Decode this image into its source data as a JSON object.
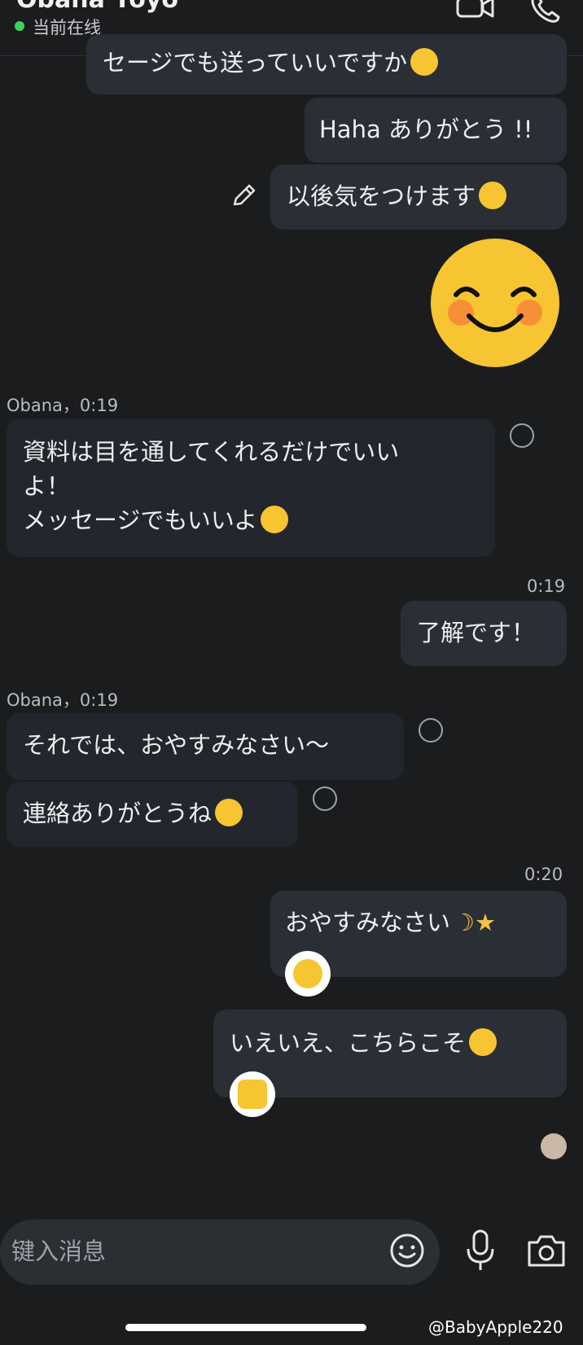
{
  "header": {
    "contact_name": "Obana Yoyo",
    "status_text": "当前在线",
    "video_call_icon": "video-camera-icon",
    "voice_call_icon": "phone-icon"
  },
  "messages": {
    "m1_text": "セージでも送っていいですか",
    "m2_text": "Haha ありがとう !!",
    "m3_text": "以後気をつけます",
    "m4_sender": "Obana，0:19",
    "m4_line1": "資料は目を通してくれるだけでいい",
    "m4_line2": "よ！",
    "m4_line3": "メッセージでもいいよ",
    "m5_time": "0:19",
    "m5_text": "了解です！",
    "m6_sender": "Obana，0:19",
    "m6_text": "それでは、おやすみなさい〜",
    "m7_text": "連絡ありがとうね",
    "m8_time": "0:20",
    "m8_text": "おやすみなさい",
    "m9_text": "いえいえ、こちらこそ"
  },
  "composer": {
    "placeholder": "键入消息",
    "emoji_icon": "smile-icon",
    "mic_icon": "microphone-icon",
    "camera_icon": "camera-icon"
  },
  "watermark": "@BabyApple220",
  "colors": {
    "background": "#1b1c1e",
    "bubble_outgoing": "#2a2f36",
    "bubble_incoming": "#23262c",
    "online_green": "#3ed160",
    "emoji_yellow": "#f7c531"
  }
}
